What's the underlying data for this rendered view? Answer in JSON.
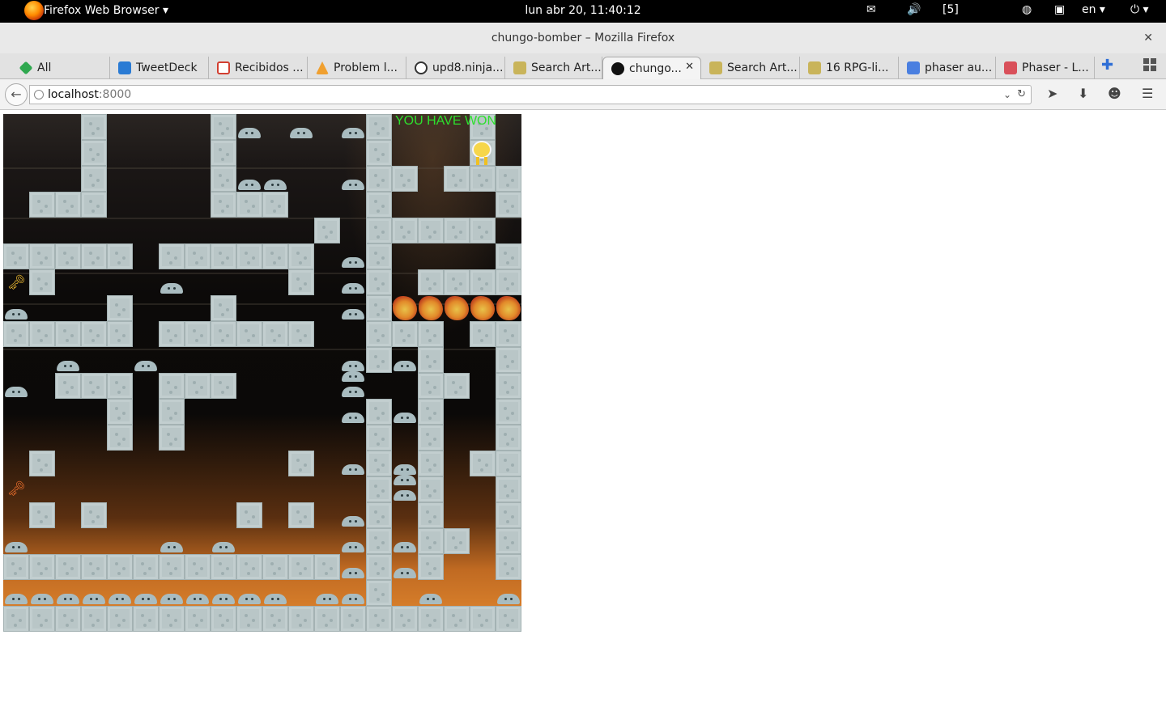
{
  "system_bar": {
    "app_menu": "Firefox Web Browser ▾",
    "clock": "lun abr 20, 11:40:12",
    "workspace": "[5]",
    "keyboard_layout": "en ▾"
  },
  "window": {
    "title": "chungo-bomber – Mozilla Firefox"
  },
  "tabs": [
    {
      "label": "All",
      "active": false
    },
    {
      "label": "TweetDeck",
      "active": false
    },
    {
      "label": "Recibidos ...",
      "active": false
    },
    {
      "label": "Problem l...",
      "active": false
    },
    {
      "label": "upd8.ninja...",
      "active": false
    },
    {
      "label": "Search Art...",
      "active": false
    },
    {
      "label": "chungo...",
      "active": true
    },
    {
      "label": "Search Art...",
      "active": false
    },
    {
      "label": "16 RPG-li...",
      "active": false
    },
    {
      "label": "phaser au...",
      "active": false
    },
    {
      "label": "Phaser - L...",
      "active": false
    }
  ],
  "url": {
    "host": "localhost",
    "port": ":8000"
  },
  "game": {
    "status_text": "YOU HAVE WON"
  },
  "colors": {
    "win_text": "#2de02d",
    "block": "#b9c6c7",
    "system_bar": "#000000"
  }
}
